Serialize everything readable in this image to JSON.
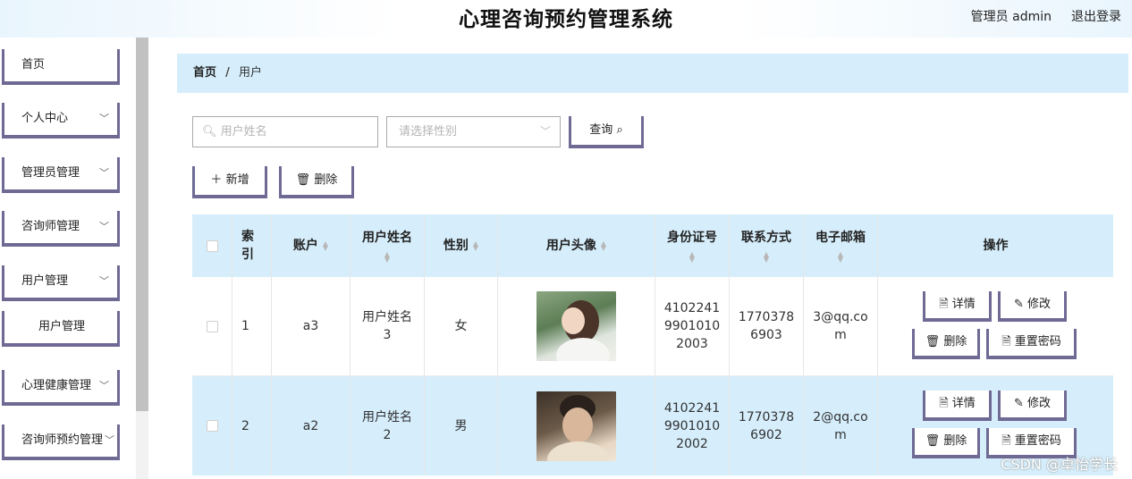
{
  "header": {
    "title": "心理咨询预约管理系统",
    "user": "管理员 admin",
    "logout": "退出登录"
  },
  "sidebar": {
    "items": [
      {
        "label": "首页"
      },
      {
        "label": "个人中心"
      },
      {
        "label": "管理员管理"
      },
      {
        "label": "咨询师管理"
      },
      {
        "label": "用户管理"
      },
      {
        "label": "用户管理"
      },
      {
        "label": "心理健康管理"
      },
      {
        "label": "咨询师预约管理"
      }
    ]
  },
  "breadcrumb": {
    "home": "首页",
    "separator": "/",
    "current": "用户"
  },
  "search": {
    "name_placeholder": "用户姓名",
    "gender_placeholder": "请选择性别",
    "query_label": "查询"
  },
  "toolbar": {
    "add_label": "新增",
    "delete_label": "删除"
  },
  "table": {
    "headers": [
      "索\n引",
      "账户",
      "用户姓名",
      "性别",
      "用户头像",
      "身份证号",
      "联系方式",
      "电子邮箱",
      "操作"
    ],
    "rows": [
      {
        "index": "1",
        "account": "a3",
        "name": "用户姓名\n3",
        "gender": "女",
        "id_card": "4102241\n9901010\n2003",
        "phone": "1770378\n6903",
        "email": "3@qq.co\nm"
      },
      {
        "index": "2",
        "account": "a2",
        "name": "用户姓名\n2",
        "gender": "男",
        "id_card": "4102241\n9901010\n2002",
        "phone": "1770378\n6902",
        "email": "2@qq.co\nm"
      }
    ],
    "actions": {
      "detail": "详情",
      "edit": "修改",
      "delete": "删除",
      "reset": "重置密码"
    }
  },
  "watermark": "CSDN @卓怡学长"
}
